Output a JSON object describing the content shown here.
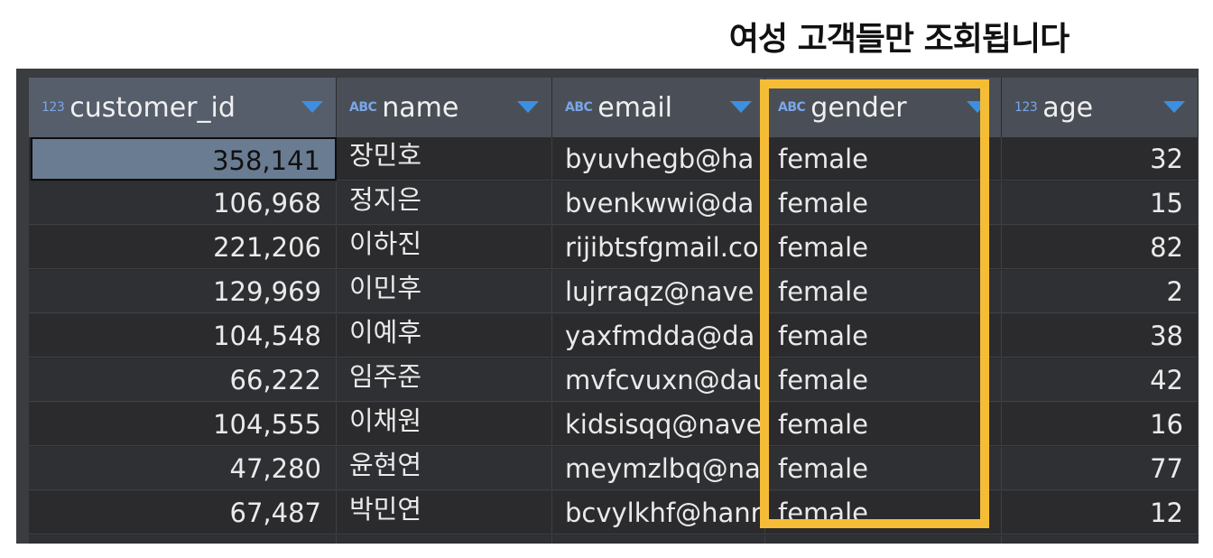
{
  "caption": "여성 고객들만 조회됩니다",
  "colors": {
    "highlight": "#f5bd36",
    "sort_accent": "#3d8fe0",
    "selected_cell": "#6a7c92"
  },
  "columns": [
    {
      "type": "123",
      "label": "customer_id",
      "icon": "sort-dropdown-icon"
    },
    {
      "type": "ABC",
      "label": "name",
      "icon": "sort-dropdown-icon"
    },
    {
      "type": "ABC",
      "label": "email",
      "icon": "sort-dropdown-icon"
    },
    {
      "type": "ABC",
      "label": "gender",
      "icon": "sort-dropdown-icon"
    },
    {
      "type": "123",
      "label": "age",
      "icon": "sort-dropdown-icon"
    }
  ],
  "rows": [
    {
      "customer_id": "358,141",
      "name": "장민호",
      "email": "byuvhegb@ha",
      "gender": "female",
      "age": "32"
    },
    {
      "customer_id": "106,968",
      "name": "정지은",
      "email": "bvenkwwi@da",
      "gender": "female",
      "age": "15"
    },
    {
      "customer_id": "221,206",
      "name": "이하진",
      "email": "rijibtsfgmail.co",
      "gender": "female",
      "age": "82"
    },
    {
      "customer_id": "129,969",
      "name": "이민후",
      "email": "lujrraqz@nave",
      "gender": "female",
      "age": "2"
    },
    {
      "customer_id": "104,548",
      "name": "이예후",
      "email": "yaxfmdda@da",
      "gender": "female",
      "age": "38"
    },
    {
      "customer_id": "66,222",
      "name": "임주준",
      "email": "mvfcvuxn@dau",
      "gender": "female",
      "age": "42"
    },
    {
      "customer_id": "104,555",
      "name": "이채원",
      "email": "kidsisqq@nave",
      "gender": "female",
      "age": "16"
    },
    {
      "customer_id": "47,280",
      "name": "윤현연",
      "email": "meymzlbq@na",
      "gender": "female",
      "age": "77"
    },
    {
      "customer_id": "67,487",
      "name": "박민연",
      "email": "bcvylkhf@hanr",
      "gender": "female",
      "age": "12"
    }
  ]
}
